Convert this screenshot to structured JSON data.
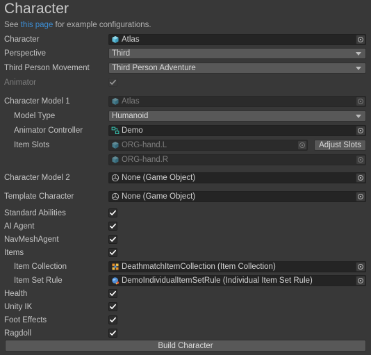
{
  "header": {
    "title": "Character",
    "subtitle_pre": "See ",
    "subtitle_link": "this page",
    "subtitle_post": " for example configurations."
  },
  "colors": {
    "background": "#383838",
    "field_dark": "#242424",
    "field_light": "#585858",
    "text": "#c4c4c4",
    "text_dim": "#7d7d7d",
    "link": "#3d8fd6",
    "icon_prefab_blue": "#5fbdd8",
    "icon_animator_teal": "#39c9b5",
    "icon_collection_orange": "#e8912a",
    "icon_rule_blue": "#4f8fd8"
  },
  "rows": {
    "character": {
      "label": "Character",
      "value": "Atlas",
      "icon": "prefab-cube-icon",
      "selector": "object-selector-icon"
    },
    "perspective": {
      "label": "Perspective",
      "value": "Third",
      "icon": "chevron-down-icon"
    },
    "third_person_movement": {
      "label": "Third Person Movement",
      "value": "Third Person Adventure",
      "icon": "chevron-down-icon"
    },
    "animator": {
      "label": "Animator",
      "checked": true,
      "disabled": true
    },
    "character_model_1": {
      "label": "Character Model 1",
      "value": "Atlas",
      "icon": "prefab-cube-icon",
      "disabled": true
    },
    "model_type": {
      "label": "Model Type",
      "value": "Humanoid",
      "icon": "chevron-down-icon"
    },
    "animator_controller": {
      "label": "Animator Controller",
      "value": "Demo",
      "icon": "animator-controller-icon"
    },
    "item_slots": {
      "label": "Item Slots",
      "slot_1": "ORG-hand.L",
      "slot_2": "ORG-hand.R",
      "icon": "prefab-cube-icon",
      "button_label": "Adjust Slots"
    },
    "character_model_2": {
      "label": "Character Model 2",
      "value": "None (Game Object)",
      "icon": "game-object-icon"
    },
    "template_character": {
      "label": "Template Character",
      "value": "None (Game Object)",
      "icon": "game-object-icon"
    },
    "standard_abilities": {
      "label": "Standard Abilities",
      "checked": true
    },
    "ai_agent": {
      "label": "AI Agent",
      "checked": true
    },
    "navmeshagent": {
      "label": "NavMeshAgent",
      "checked": true
    },
    "items": {
      "label": "Items",
      "checked": true
    },
    "item_collection": {
      "label": "Item Collection",
      "value": "DeathmatchItemCollection (Item Collection)",
      "icon": "item-collection-icon"
    },
    "item_set_rule": {
      "label": "Item Set Rule",
      "value": "DemoIndividualItemSetRule (Individual Item Set Rule)",
      "icon": "item-set-rule-icon"
    },
    "health": {
      "label": "Health",
      "checked": true
    },
    "unity_ik": {
      "label": "Unity IK",
      "checked": true
    },
    "foot_effects": {
      "label": "Foot Effects",
      "checked": true
    },
    "ragdoll": {
      "label": "Ragdoll",
      "checked": true
    }
  },
  "footer": {
    "build_button": "Build Character"
  }
}
